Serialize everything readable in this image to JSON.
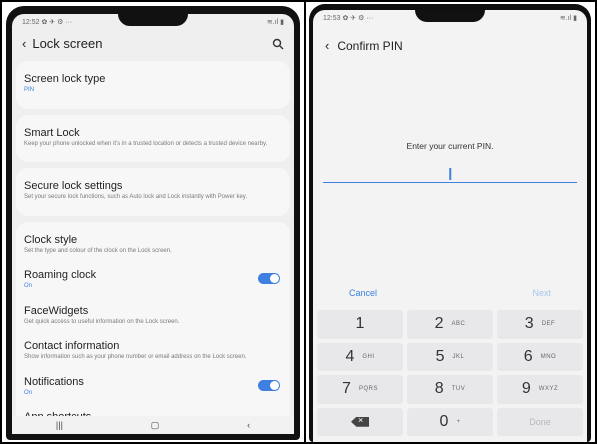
{
  "left_screen": {
    "status_time": "12:52 ✿ ✈ ⚙ ···",
    "status_right": "≋.ıl ▮",
    "appbar": {
      "back_icon": "‹",
      "title": "Lock screen"
    },
    "groups": [
      [
        {
          "title": "Screen lock type",
          "sub": "PIN",
          "sub_color": "blue"
        }
      ],
      [
        {
          "title": "Smart Lock",
          "sub": "Keep your phone unlocked when it's in a trusted location or detects a trusted device nearby."
        }
      ],
      [
        {
          "title": "Secure lock settings",
          "sub": "Set your secure lock functions, such as Auto lock and Lock instantly with Power key."
        }
      ],
      [
        {
          "title": "Clock style",
          "sub": "Set the type and colour of the clock on the Lock screen."
        },
        {
          "title": "Roaming clock",
          "sub": "On",
          "sub_color": "blue",
          "toggle": true
        },
        {
          "title": "FaceWidgets",
          "sub": "Get quick access to useful information on the Lock screen."
        },
        {
          "title": "Contact information",
          "sub": "Show information such as your phone number or email address on the Lock screen."
        },
        {
          "title": "Notifications",
          "sub": "On",
          "sub_color": "blue",
          "toggle": true
        },
        {
          "title": "App shortcuts",
          "sub": ""
        }
      ]
    ],
    "nav": {
      "recent": "|||",
      "home": "▢",
      "back": "‹"
    }
  },
  "right_screen": {
    "status_time": "12:53 ✿ ✈ ⚙ ···",
    "status_right": "≋.ıl ▮",
    "appbar": {
      "back_icon": "‹",
      "title": "Confirm PIN"
    },
    "prompt": "Enter your current PIN.",
    "actions": {
      "cancel": "Cancel",
      "next": "Next"
    },
    "keypad": [
      {
        "num": "1",
        "letters": ""
      },
      {
        "num": "2",
        "letters": "ABC"
      },
      {
        "num": "3",
        "letters": "DEF"
      },
      {
        "num": "4",
        "letters": "GHI"
      },
      {
        "num": "5",
        "letters": "JKL"
      },
      {
        "num": "6",
        "letters": "MNO"
      },
      {
        "num": "7",
        "letters": "PQRS"
      },
      {
        "num": "8",
        "letters": "TUV"
      },
      {
        "num": "9",
        "letters": "WXYZ"
      },
      {
        "num": "",
        "letters": "",
        "type": "backspace"
      },
      {
        "num": "0",
        "letters": "+"
      },
      {
        "num": "",
        "letters": "Done",
        "type": "done"
      }
    ]
  },
  "colors": {
    "accent": "#3e7fe0",
    "bg_left": "#efeff0",
    "bg_right": "#f3f3f4"
  }
}
